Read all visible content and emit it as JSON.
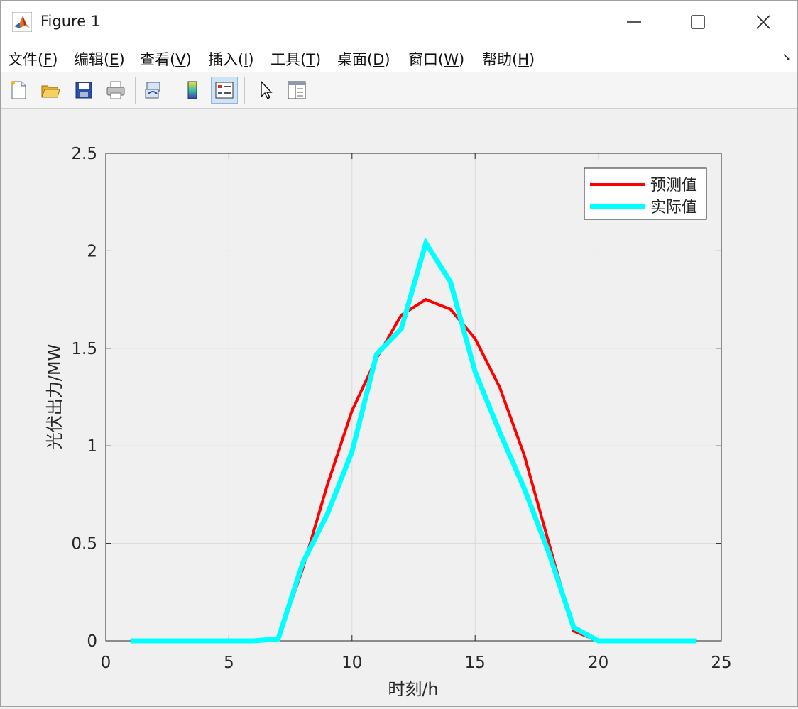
{
  "window": {
    "title": "Figure 1"
  },
  "menu": [
    {
      "label": "文件(",
      "acc": "F",
      "tail": ")"
    },
    {
      "label": "编辑(",
      "acc": "E",
      "tail": ")"
    },
    {
      "label": "查看(",
      "acc": "V",
      "tail": ")"
    },
    {
      "label": "插入(",
      "acc": "I",
      "tail": ")"
    },
    {
      "label": "工具(",
      "acc": "T",
      "tail": ")"
    },
    {
      "label": "桌面(",
      "acc": "D",
      "tail": ")"
    },
    {
      "label": "窗口(",
      "acc": "W",
      "tail": ")"
    },
    {
      "label": "帮助(",
      "acc": "H",
      "tail": ")"
    }
  ],
  "toolbar_icons": [
    "new-file-icon",
    "open-folder-icon",
    "save-icon",
    "print-icon",
    "link-plot-icon",
    "colorbar-icon",
    "legend-icon",
    "pointer-icon",
    "property-inspector-icon"
  ],
  "colors": {
    "predicted": "#ff0000",
    "actual": "#00ffff"
  },
  "chart_data": {
    "type": "line",
    "xlabel": "时刻/h",
    "ylabel": "光伏出力/MW",
    "xlim": [
      0,
      25
    ],
    "ylim": [
      0,
      2.5
    ],
    "xticks": [
      0,
      5,
      10,
      15,
      20,
      25
    ],
    "yticks": [
      0,
      0.5,
      1,
      1.5,
      2,
      2.5
    ],
    "ytick_labels": [
      "0",
      "0.5",
      "1",
      "1.5",
      "2",
      "2.5"
    ],
    "grid": true,
    "legend_position": "top-right",
    "x": [
      1,
      2,
      3,
      4,
      5,
      6,
      7,
      8,
      9,
      10,
      11,
      12,
      13,
      14,
      15,
      16,
      17,
      18,
      19,
      20,
      21,
      22,
      23,
      24
    ],
    "series": [
      {
        "name": "预测值",
        "color": "#ff0000",
        "values": [
          0,
          0,
          0,
          0,
          0,
          0,
          0.01,
          0.37,
          0.8,
          1.18,
          1.45,
          1.67,
          1.75,
          1.7,
          1.55,
          1.3,
          0.95,
          0.5,
          0.05,
          0,
          0,
          0,
          0,
          0
        ]
      },
      {
        "name": "实际值",
        "color": "#00ffff",
        "values": [
          0,
          0,
          0,
          0,
          0,
          0,
          0.01,
          0.4,
          0.65,
          0.97,
          1.47,
          1.6,
          2.04,
          1.84,
          1.38,
          1.07,
          0.78,
          0.45,
          0.07,
          0,
          0,
          0,
          0,
          0
        ]
      }
    ]
  }
}
